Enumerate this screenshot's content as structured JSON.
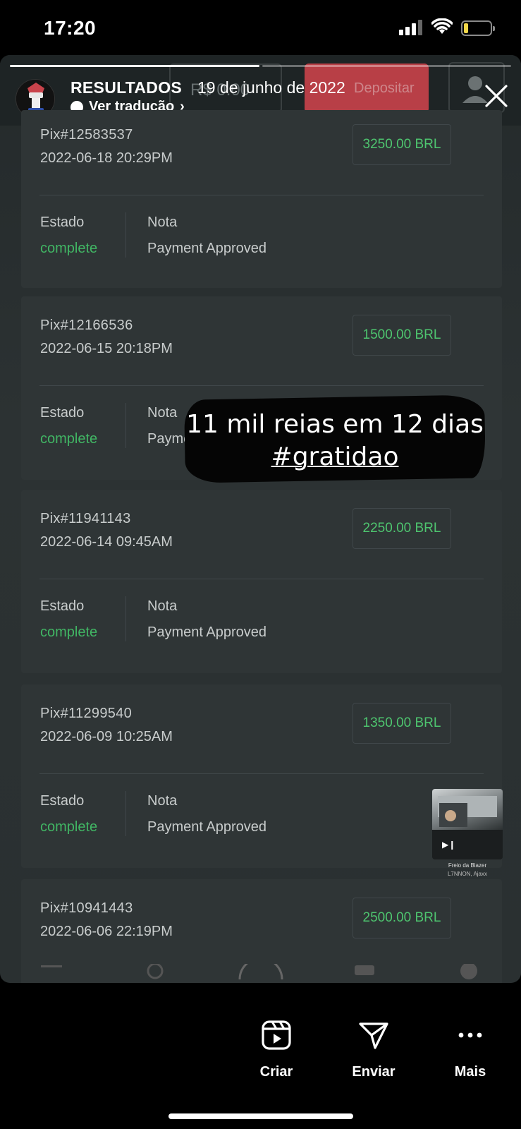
{
  "status_bar": {
    "time": "17:20"
  },
  "story": {
    "account_name": "RESULTADOS",
    "date_overlay": "19 de junho de 2022",
    "translate_label": "Ver tradução",
    "background_header": {
      "left_text": "R$ 0.00",
      "button_text": "Depositar"
    },
    "progress_segments": [
      true,
      false
    ],
    "sticker": {
      "line1": "11 mil reias em 12 dias",
      "line2": "#gratidao"
    },
    "music": {
      "song": "Freio da Blazer",
      "artist": "L7NNON, Ajaxx"
    }
  },
  "transactions": [
    {
      "id": "Pix#12583537",
      "datetime": "2022-06-18 20:29PM",
      "amount": "3250.00 BRL",
      "state_label": "Estado",
      "state": "complete",
      "note_label": "Nota",
      "note": "Payment Approved"
    },
    {
      "id": "Pix#12166536",
      "datetime": "2022-06-15 20:18PM",
      "amount": "1500.00 BRL",
      "state_label": "Estado",
      "state": "complete",
      "note_label": "Nota",
      "note": "Payme"
    },
    {
      "id": "Pix#11941143",
      "datetime": "2022-06-14 09:45AM",
      "amount": "2250.00 BRL",
      "state_label": "Estado",
      "state": "complete",
      "note_label": "Nota",
      "note": "Payment Approved"
    },
    {
      "id": "Pix#11299540",
      "datetime": "2022-06-09 10:25AM",
      "amount": "1350.00 BRL",
      "state_label": "Estado",
      "state": "complete",
      "note_label": "Nota",
      "note": "Payment Approved"
    },
    {
      "id": "Pix#10941443",
      "datetime": "2022-06-06 22:19PM",
      "amount": "2500.00 BRL"
    }
  ],
  "actions": [
    {
      "label": "Criar",
      "icon": "reels-create-icon"
    },
    {
      "label": "Enviar",
      "icon": "send-icon"
    },
    {
      "label": "Mais",
      "icon": "more-icon"
    }
  ],
  "colors": {
    "accent_green": "#41b664",
    "amount_green": "#4ec56f",
    "card_bg": "#2f3536",
    "deposit_red": "#c9434b"
  }
}
